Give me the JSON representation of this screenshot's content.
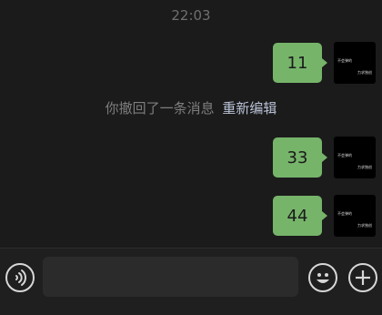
{
  "chat": {
    "time": "22:03",
    "recall": {
      "text": "你撤回了一条消息",
      "action": "重新编辑"
    },
    "messages": [
      {
        "text": "11"
      },
      {
        "text": "33"
      },
      {
        "text": "44"
      }
    ],
    "avatar": {
      "line1": "不会弹的",
      "line2": "力求独创"
    }
  },
  "input": {
    "placeholder": "",
    "value": ""
  },
  "icons": {
    "voice": "voice-icon",
    "emoji": "emoji-icon",
    "plus": "plus-icon"
  },
  "colors": {
    "bubble": "#76b46a",
    "background": "#1b1b1b",
    "input": "#2b2b2b"
  }
}
